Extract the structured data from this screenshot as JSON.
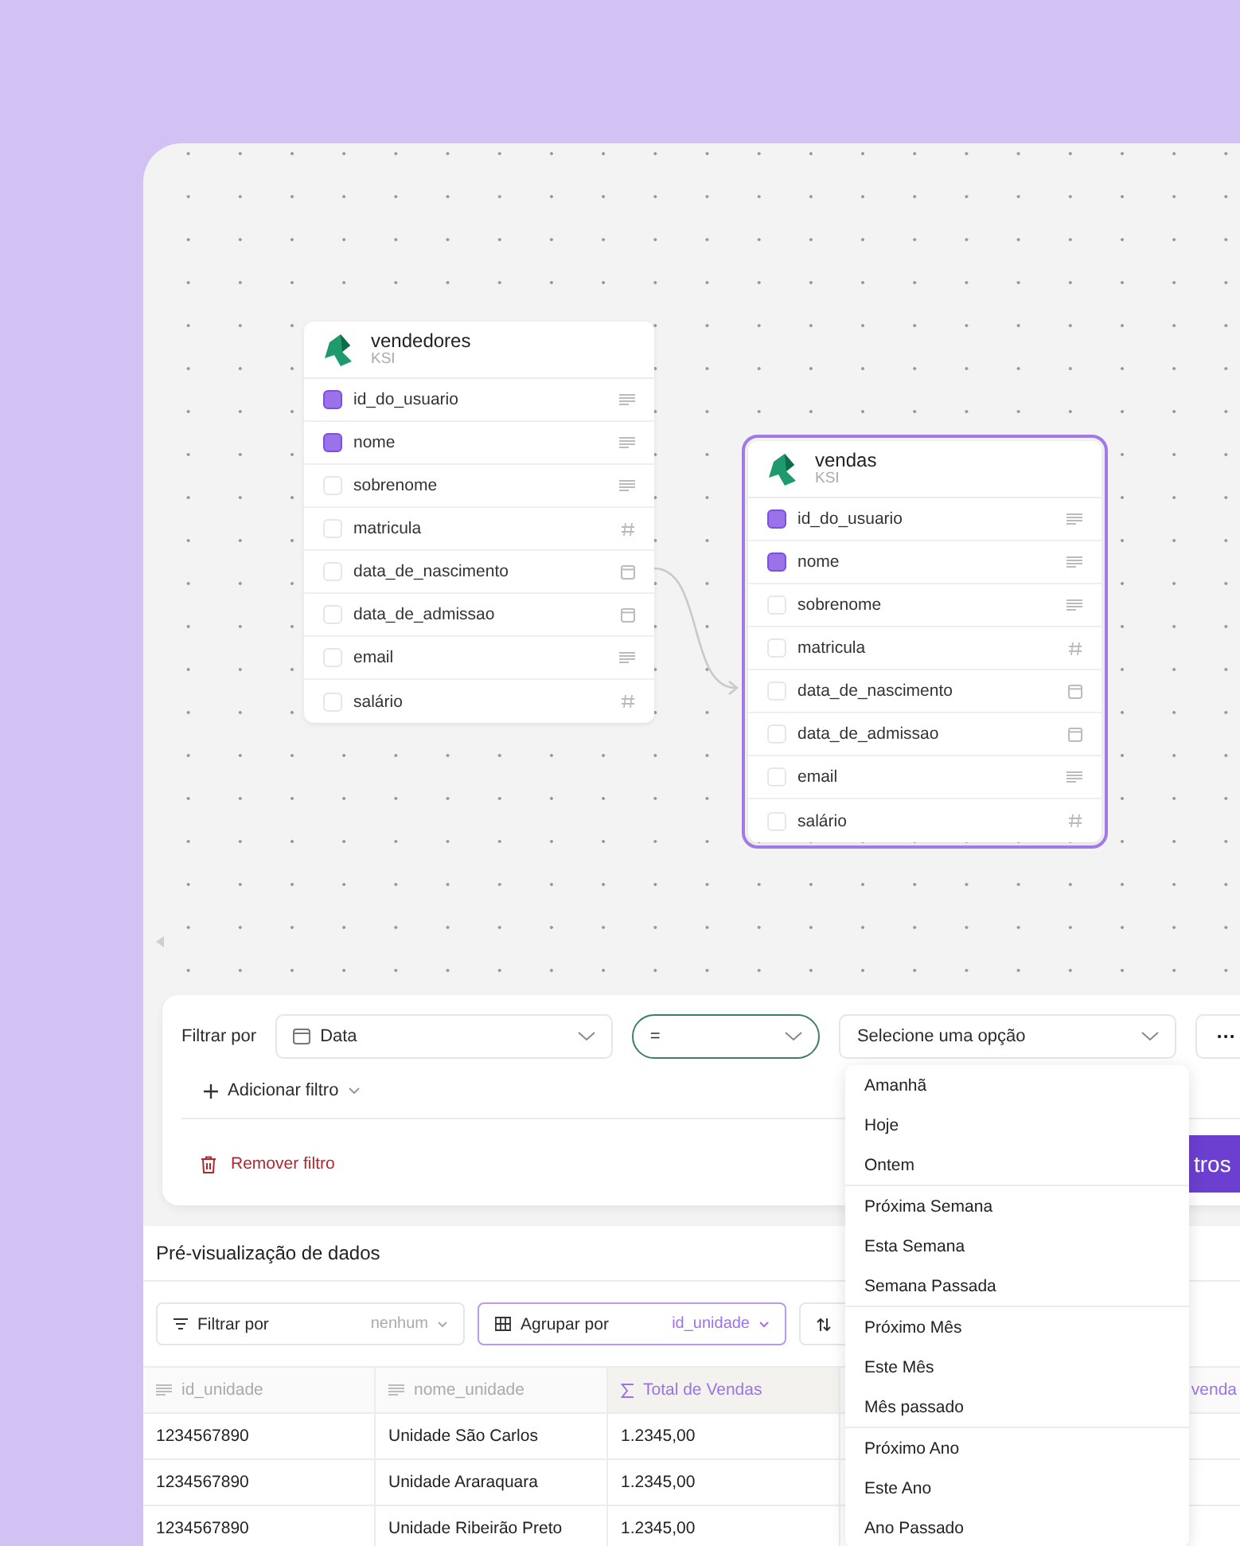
{
  "canvas": {
    "nodes": [
      {
        "title": "vendedores",
        "subtitle": "KSI",
        "selected": false,
        "fields": [
          {
            "name": "id_do_usuario",
            "checked": true,
            "kind": "text"
          },
          {
            "name": "nome",
            "checked": true,
            "kind": "text"
          },
          {
            "name": "sobrenome",
            "checked": false,
            "kind": "text"
          },
          {
            "name": "matricula",
            "checked": false,
            "kind": "number"
          },
          {
            "name": "data_de_nascimento",
            "checked": false,
            "kind": "date"
          },
          {
            "name": "data_de_admissao",
            "checked": false,
            "kind": "date"
          },
          {
            "name": "email",
            "checked": false,
            "kind": "text"
          },
          {
            "name": "salário",
            "checked": false,
            "kind": "number"
          }
        ]
      },
      {
        "title": "vendas",
        "subtitle": "KSI",
        "selected": true,
        "fields": [
          {
            "name": "id_do_usuario",
            "checked": true,
            "kind": "text"
          },
          {
            "name": "nome",
            "checked": true,
            "kind": "text"
          },
          {
            "name": "sobrenome",
            "checked": false,
            "kind": "text"
          },
          {
            "name": "matricula",
            "checked": false,
            "kind": "number"
          },
          {
            "name": "data_de_nascimento",
            "checked": false,
            "kind": "date"
          },
          {
            "name": "data_de_admissao",
            "checked": false,
            "kind": "date"
          },
          {
            "name": "email",
            "checked": false,
            "kind": "text"
          },
          {
            "name": "salário",
            "checked": false,
            "kind": "number"
          }
        ]
      }
    ]
  },
  "filter": {
    "label": "Filtrar por",
    "field": "Data",
    "operator": "=",
    "value_placeholder": "Selecione uma opção",
    "more": "···",
    "add": "Adicionar filtro",
    "remove": "Remover filtro",
    "apply": "tros",
    "option_groups": [
      [
        "Amanhã",
        "Hoje",
        "Ontem"
      ],
      [
        "Próxima Semana",
        "Esta Semana",
        "Semana Passada"
      ],
      [
        "Próximo Mês",
        "Este Mês",
        "Mês passado"
      ],
      [
        "Próximo Ano",
        "Este Ano",
        "Ano Passado"
      ]
    ]
  },
  "preview": {
    "title": "Pré-visualização de dados",
    "toolbar": [
      {
        "kind": "filter",
        "label": "Filtrar por",
        "value": "nenhum",
        "active": false
      },
      {
        "kind": "group",
        "label": "Agrupar por",
        "value": "id_unidade",
        "active": true
      },
      {
        "kind": "sort",
        "active": false
      }
    ],
    "columns": [
      {
        "label": "id_unidade",
        "kind": "text",
        "highlighted": false
      },
      {
        "label": "nome_unidade",
        "kind": "text",
        "highlighted": false
      },
      {
        "label": "Total de Vendas",
        "kind": "sum",
        "highlighted": true
      }
    ],
    "column_4": "venda",
    "rows": [
      [
        "1234567890",
        "Unidade São Carlos",
        "1.2345,00"
      ],
      [
        "1234567890",
        "Unidade Araraquara",
        "1.2345,00"
      ],
      [
        "1234567890",
        "Unidade Ribeirão Preto",
        "1.2345,00"
      ]
    ]
  }
}
